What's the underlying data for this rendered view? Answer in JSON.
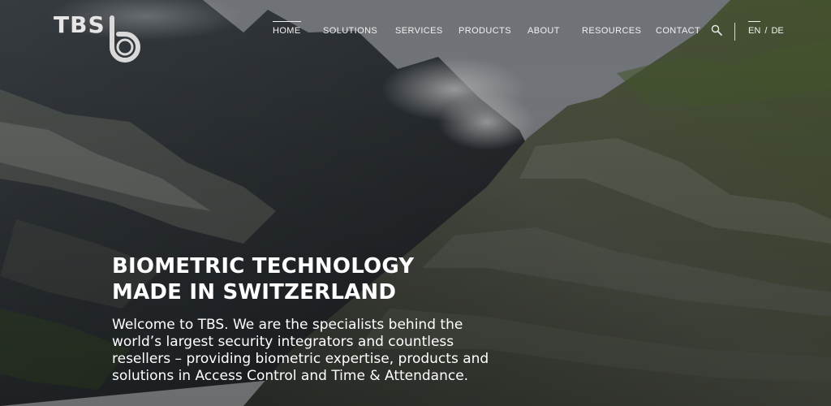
{
  "brand": {
    "logo_text": "TBS"
  },
  "nav": {
    "items": [
      {
        "label": "HOME",
        "active": true
      },
      {
        "label": "SOLUTIONS",
        "active": false
      },
      {
        "label": "SERVICES",
        "active": false
      },
      {
        "label": "PRODUCTS",
        "active": false
      },
      {
        "label": "ABOUT",
        "active": false
      },
      {
        "label": "RESOURCES",
        "active": false
      },
      {
        "label": "CONTACT",
        "active": false
      }
    ],
    "search_icon": "search-icon",
    "language": {
      "en": "EN",
      "separator": "/",
      "de": "DE",
      "active": "EN"
    }
  },
  "hero": {
    "headline_line1": "BIOMETRIC TECHNOLOGY",
    "headline_line2": "MADE IN SWITZERLAND",
    "intro_lines": [
      "Welcome to TBS. We are the specialists behind the",
      "world’s largest security integrators and countless",
      "resellers – providing biometric expertise, products and",
      "solutions in Access Control and Time & Attendance."
    ]
  },
  "colors": {
    "text": "#ffffff",
    "nav_text": "#f2f2f2",
    "sky": "#8d9094",
    "rock_dark": "#2f3437",
    "grass": "#5c6b3a"
  }
}
